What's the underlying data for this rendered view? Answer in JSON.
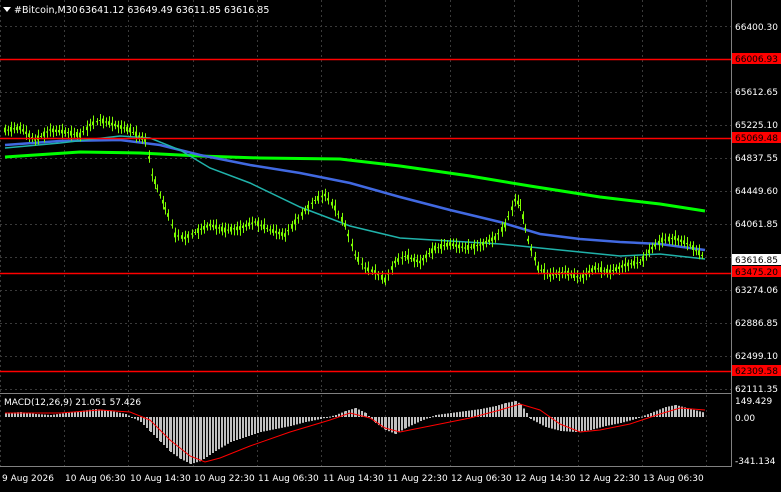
{
  "header": {
    "symbol_label": "#Bitcoin,M30",
    "ohlc": "63641.12 63649.49 63611.85 63616.85",
    "menu_icon": "triangle-down-icon"
  },
  "price_axis": {
    "ticks": [
      "66400.30",
      "65612.65",
      "65225.10",
      "64837.55",
      "64449.60",
      "64061.85",
      "63274.06",
      "62886.85",
      "62499.10",
      "62111.35"
    ],
    "current_price": "63616.85"
  },
  "levels": [
    {
      "label": "66006.93",
      "price": 66006.93
    },
    {
      "label": "65069.48",
      "price": 65069.48
    },
    {
      "label": "63475.20",
      "price": 63475.2
    },
    {
      "label": "62309.58",
      "price": 62309.58
    }
  ],
  "time_axis": {
    "labels": [
      "9 Aug 2026",
      "10 Aug 06:30",
      "10 Aug 14:30",
      "10 Aug 22:30",
      "11 Aug 06:30",
      "11 Aug 14:30",
      "11 Aug 22:30",
      "12 Aug 06:30",
      "12 Aug 14:30",
      "12 Aug 22:30",
      "13 Aug 06:30"
    ]
  },
  "macd": {
    "label": "MACD(12,26,9) 21.051 57.426",
    "axis_ticks": [
      "149.429",
      "0.00",
      "-341.134"
    ]
  },
  "colors": {
    "background": "#000000",
    "grid": "#3a3a3a",
    "candles": "#7cfc00",
    "level_line": "#ff0000",
    "level_label_bg": "#ff0000",
    "ma_green": "#00ff00",
    "ma_blue": "#4169e1",
    "ma_teal": "#20b2aa",
    "macd_hist": "#c0c0c0",
    "macd_signal": "#ff0000"
  }
}
